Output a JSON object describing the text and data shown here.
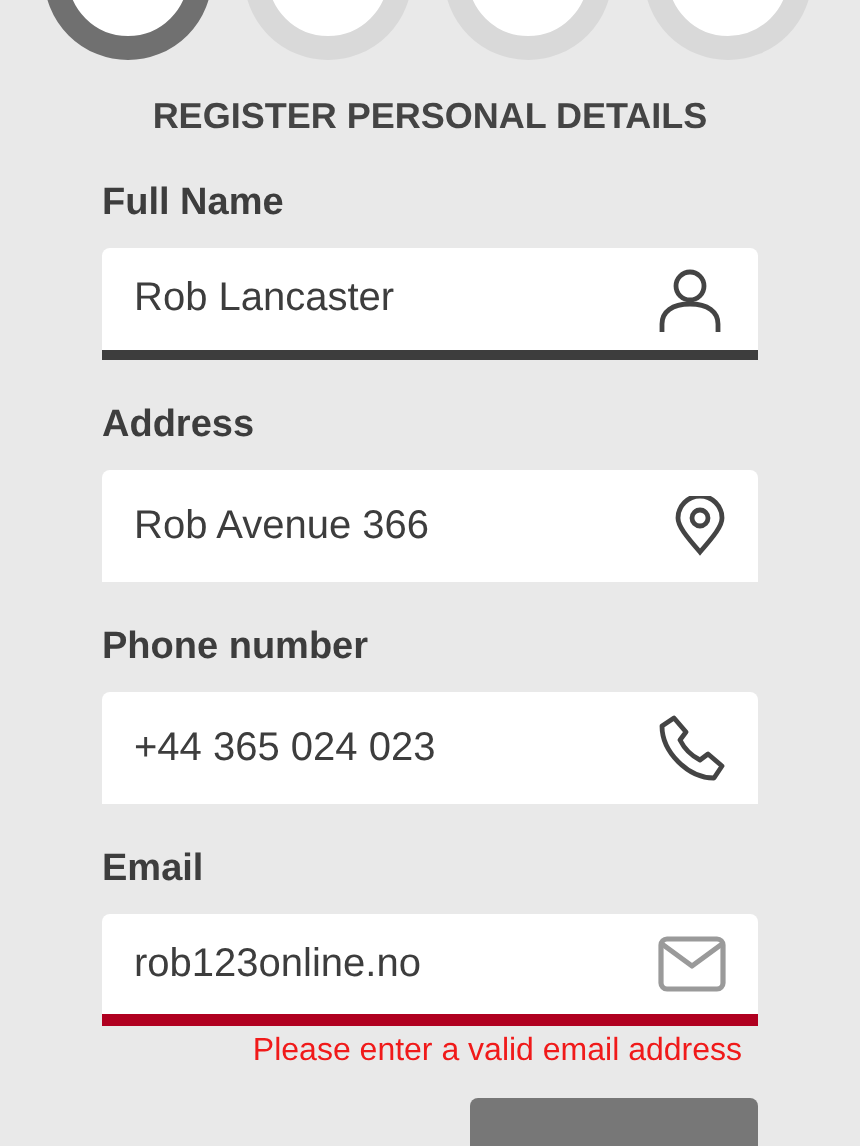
{
  "steps": [
    {
      "selected": true
    },
    {
      "selected": false
    },
    {
      "selected": false
    },
    {
      "selected": false
    }
  ],
  "title": "REGISTER PERSONAL DETAILS",
  "fields": [
    {
      "label": "Full Name",
      "value": "Rob Lancaster",
      "kind": "person",
      "focused": true,
      "invalid": false
    },
    {
      "label": "Address",
      "value": "Rob Avenue 366",
      "kind": "pin",
      "focused": false,
      "invalid": false
    },
    {
      "label": "Phone number",
      "value": "+44 365 024 023",
      "kind": "phone",
      "focused": false,
      "invalid": false
    },
    {
      "label": "Email",
      "value": "rob123online.no",
      "kind": "mail",
      "focused": false,
      "invalid": true,
      "error": "Please enter a valid email address"
    }
  ],
  "button": {
    "disabled": true
  }
}
